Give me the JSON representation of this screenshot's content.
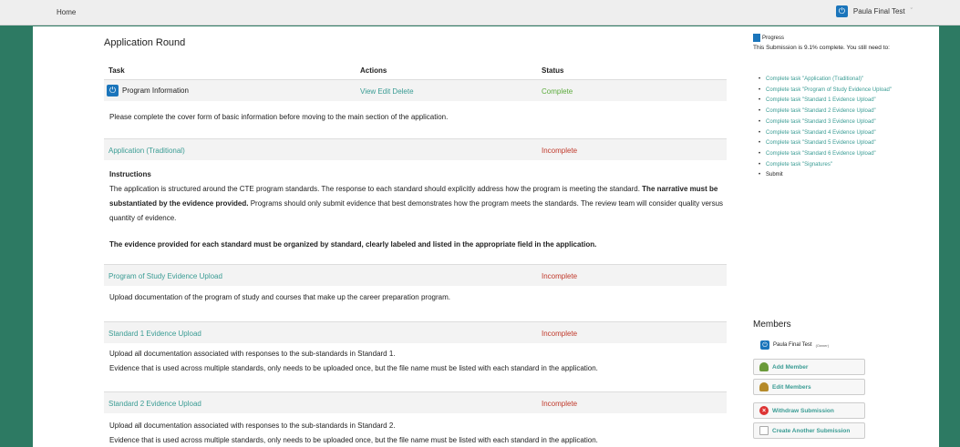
{
  "topbar": {
    "home_label": "Home",
    "user_name": "Paula Final Test",
    "caret": "ˇ"
  },
  "round_title": "Application Round",
  "columns": {
    "task": "Task",
    "actions": "Actions",
    "status": "Status"
  },
  "tasks": [
    {
      "name": "Program Information",
      "actions": "View Edit Delete",
      "status": "Complete"
    },
    {
      "name": "Application (Traditional)",
      "actions": "",
      "status": "Incomplete"
    },
    {
      "name": "Program of Study Evidence Upload",
      "actions": "",
      "status": "Incomplete"
    },
    {
      "name": "Standard 1 Evidence Upload",
      "actions": "",
      "status": "Incomplete"
    },
    {
      "name": "Standard 2 Evidence Upload",
      "actions": "",
      "status": "Incomplete"
    }
  ],
  "descriptions": {
    "program_info": "Please complete the cover form of basic information before moving to the main section of the application.",
    "app_instructions_title": "Instructions",
    "app_p1_a": "The application is structured around the CTE program standards. The response to each standard should explicitly address how the program is meeting the standard. ",
    "app_p1_b": "The narrative must be substantiated by the evidence provided.",
    "app_p1_c": "  Programs should only submit evidence that best demonstrates how the program meets the standards. The review team will consider quality versus quantity of evidence.",
    "app_p2": "The evidence provided for each standard must be organized by standard, clearly labeled and listed in the appropriate field in the application.",
    "pos": "Upload documentation of the program of study and courses that make up the career preparation program.",
    "std1_l1": "Upload all documentation associated with responses to the sub-standards in Standard 1.",
    "std1_l2": "Evidence that is used across multiple standards, only needs to be uploaded once, but the file name must be listed with each standard in the application.",
    "std2_l1": "Upload all documentation associated with responses to the sub-standards in Standard 2.",
    "std2_l2": "Evidence that is used across multiple standards, only needs to be uploaded once, but the file name must be listed with each standard in the application."
  },
  "progress": {
    "title": "Progress",
    "summary": "This Submission is 9.1% complete. You still need to:",
    "items": [
      "Complete task \"Application (Traditional)\"",
      "Complete task \"Program of Study Evidence Upload\"",
      "Complete task \"Standard 1 Evidence Upload\"",
      "Complete task \"Standard 2 Evidence Upload\"",
      "Complete task \"Standard 3 Evidence Upload\"",
      "Complete task \"Standard 4 Evidence Upload\"",
      "Complete task \"Standard 5 Evidence Upload\"",
      "Complete task \"Standard 6 Evidence Upload\"",
      "Complete task \"Signatures\""
    ],
    "submit": "Submit"
  },
  "members": {
    "title": "Members",
    "member_name": "Paula Final Test",
    "member_role": "(Owner)",
    "add": "Add Member",
    "edit": "Edit Members",
    "withdraw": "Withdraw Submission",
    "create": "Create Another Submission"
  },
  "colors": {
    "accent": "#3a9c94",
    "complete": "#5cab3c",
    "incomplete": "#c0392b",
    "background": "#2d7a63"
  }
}
